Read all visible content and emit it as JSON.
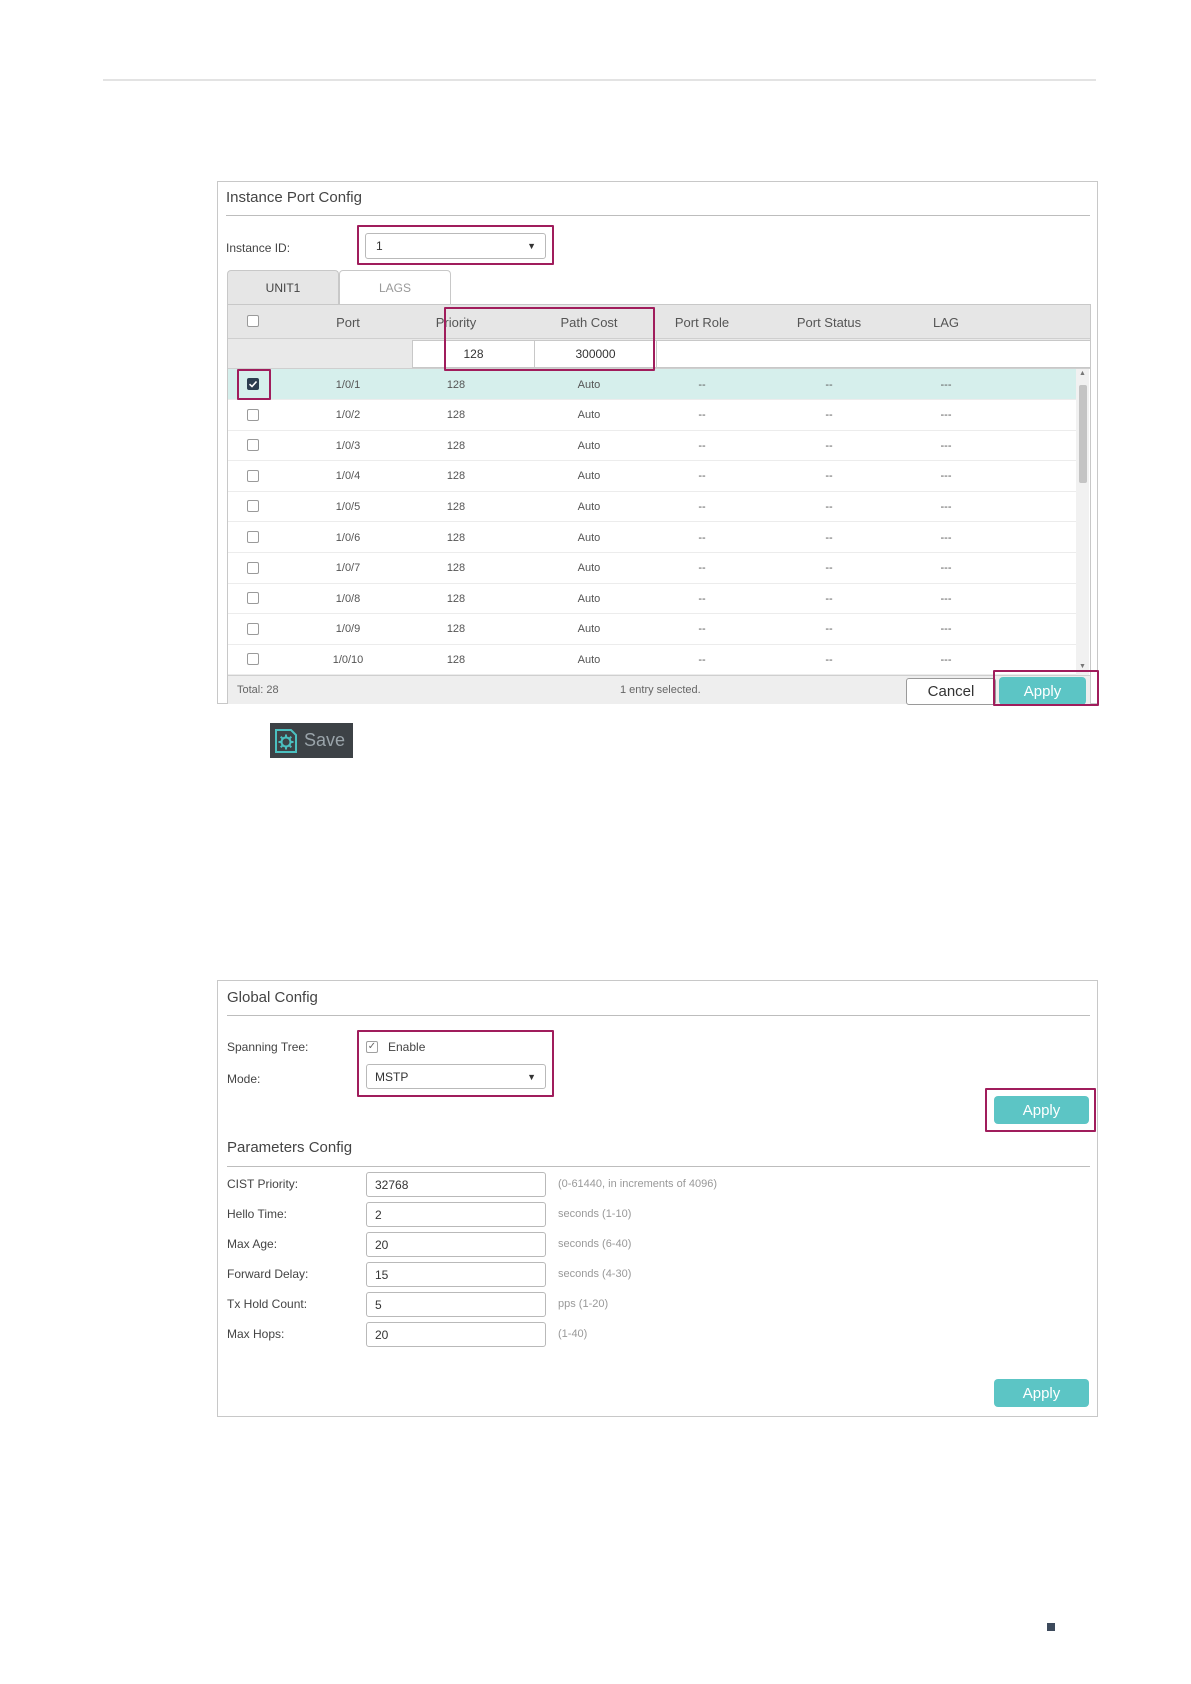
{
  "instance_port_config": {
    "title": "Instance Port Config",
    "instance_id_label": "Instance ID:",
    "instance_id_value": "1",
    "tabs": [
      "UNIT1",
      "LAGS"
    ],
    "columns": [
      "Port",
      "Priority",
      "Path Cost",
      "Port Role",
      "Port Status",
      "LAG"
    ],
    "edit_priority": "128",
    "edit_path_cost": "300000",
    "rows": [
      {
        "port": "1/0/1",
        "priority": "128",
        "path_cost": "Auto",
        "role": "--",
        "status": "--",
        "lag": "---",
        "checked": true
      },
      {
        "port": "1/0/2",
        "priority": "128",
        "path_cost": "Auto",
        "role": "--",
        "status": "--",
        "lag": "---",
        "checked": false
      },
      {
        "port": "1/0/3",
        "priority": "128",
        "path_cost": "Auto",
        "role": "--",
        "status": "--",
        "lag": "---",
        "checked": false
      },
      {
        "port": "1/0/4",
        "priority": "128",
        "path_cost": "Auto",
        "role": "--",
        "status": "--",
        "lag": "---",
        "checked": false
      },
      {
        "port": "1/0/5",
        "priority": "128",
        "path_cost": "Auto",
        "role": "--",
        "status": "--",
        "lag": "---",
        "checked": false
      },
      {
        "port": "1/0/6",
        "priority": "128",
        "path_cost": "Auto",
        "role": "--",
        "status": "--",
        "lag": "---",
        "checked": false
      },
      {
        "port": "1/0/7",
        "priority": "128",
        "path_cost": "Auto",
        "role": "--",
        "status": "--",
        "lag": "---",
        "checked": false
      },
      {
        "port": "1/0/8",
        "priority": "128",
        "path_cost": "Auto",
        "role": "--",
        "status": "--",
        "lag": "---",
        "checked": false
      },
      {
        "port": "1/0/9",
        "priority": "128",
        "path_cost": "Auto",
        "role": "--",
        "status": "--",
        "lag": "---",
        "checked": false
      },
      {
        "port": "1/0/10",
        "priority": "128",
        "path_cost": "Auto",
        "role": "--",
        "status": "--",
        "lag": "---",
        "checked": false
      }
    ],
    "total_text": "Total: 28",
    "selected_text": "1 entry selected.",
    "cancel_label": "Cancel",
    "apply_label": "Apply"
  },
  "save_label": "Save",
  "global_config": {
    "title": "Global Config",
    "spanning_tree_label": "Spanning Tree:",
    "enable_label": "Enable",
    "enable_checked": true,
    "mode_label": "Mode:",
    "mode_value": "MSTP",
    "apply_label": "Apply"
  },
  "parameters_config": {
    "title": "Parameters Config",
    "fields": [
      {
        "label": "CIST Priority:",
        "value": "32768",
        "hint": "(0-61440, in increments of 4096)"
      },
      {
        "label": "Hello Time:",
        "value": "2",
        "hint": "seconds (1-10)"
      },
      {
        "label": "Max Age:",
        "value": "20",
        "hint": "seconds (6-40)"
      },
      {
        "label": "Forward Delay:",
        "value": "15",
        "hint": "seconds (4-30)"
      },
      {
        "label": "Tx Hold Count:",
        "value": "5",
        "hint": "pps (1-20)"
      },
      {
        "label": "Max Hops:",
        "value": "20",
        "hint": "(1-40)"
      }
    ],
    "apply_label": "Apply"
  },
  "colors": {
    "accent": "#5cc5c5",
    "highlight": "#a01d5c",
    "selected_row": "#d6efec"
  }
}
